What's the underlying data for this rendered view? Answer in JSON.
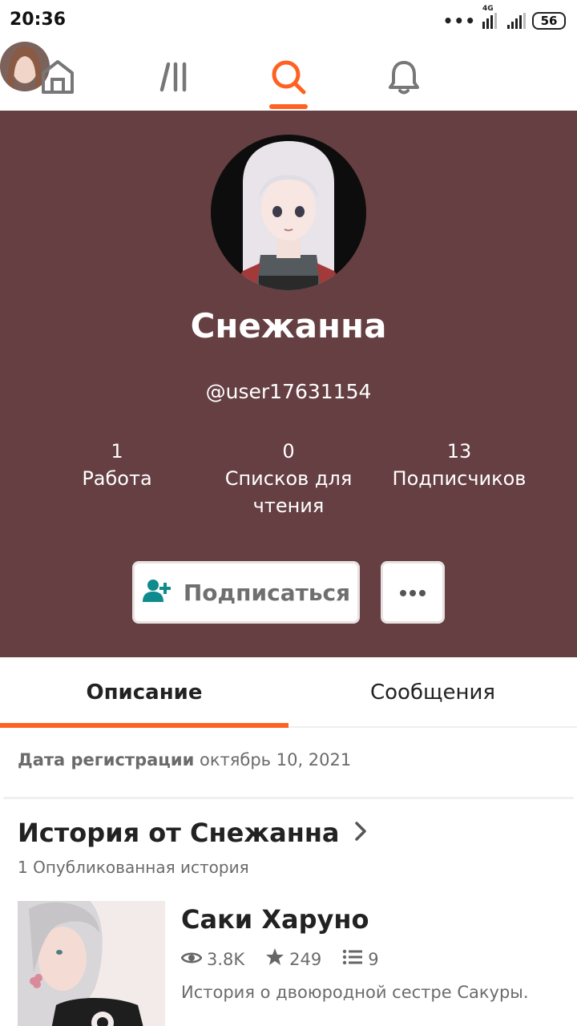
{
  "status_bar": {
    "time": "20:36",
    "network_type": "4G",
    "battery": "56"
  },
  "nav": {
    "items": [
      "home",
      "library",
      "search",
      "notifications",
      "profile"
    ],
    "active": "search",
    "accent_color": "#ff6122"
  },
  "profile": {
    "background_color": "#653f42",
    "name": "Снежанна",
    "handle": "@user17631154",
    "stats": [
      {
        "value": "1",
        "label": "Работа"
      },
      {
        "value": "0",
        "label": "Списков для чтения"
      },
      {
        "value": "13",
        "label": "Подписчиков"
      }
    ],
    "follow_label": "Подписаться"
  },
  "tabs": [
    {
      "label": "Описание",
      "active": true
    },
    {
      "label": "Сообщения",
      "active": false
    }
  ],
  "registration": {
    "label": "Дата регистрации",
    "date": "октябрь 10, 2021"
  },
  "stories": {
    "title": "История от Снежанна",
    "subtitle": "1 Опубликованная история",
    "items": [
      {
        "title": "Саки Харуно",
        "views": "3.8K",
        "votes": "249",
        "parts": "9",
        "description": "История о двоюродной сестре Сакуры."
      }
    ]
  }
}
